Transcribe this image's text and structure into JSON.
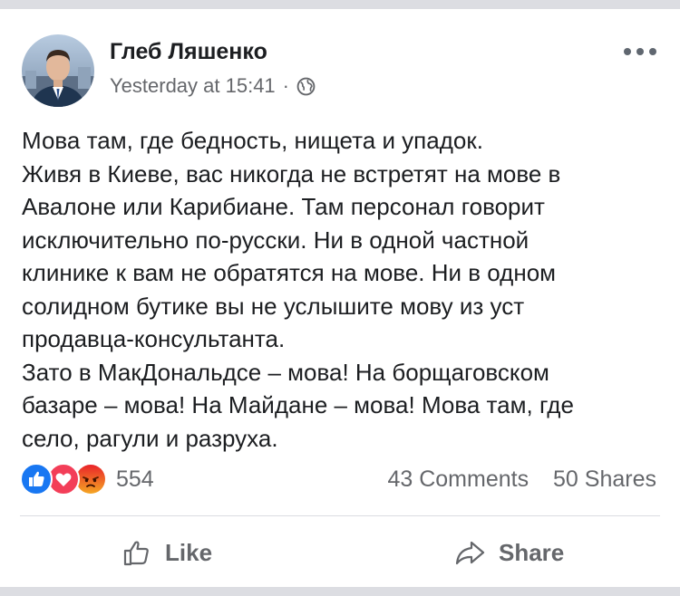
{
  "post": {
    "author": "Глеб Ляшенко",
    "timestamp": "Yesterday at 15:41",
    "separator": "·",
    "privacy_icon": "globe-icon",
    "more_icon": "more-options-icon",
    "text_lines": [
      "Мова там, где бедность, нищета и упадок.",
      "Живя в Киеве, вас никогда не встретят на мове в",
      "Авалоне или Карибиане. Там персонал говорит",
      "исключительно по-русски. Ни в одной частной",
      "клинике к вам не обратятся на мове. Ни в одном",
      "солидном бутике вы не услышите мову из уст",
      "продавца-консультанта.",
      "Зато в МакДональдсе – мова! На борщаговском",
      "базаре – мова! На Майдане – мова! Мова там, где",
      "село, рагули и разруха."
    ]
  },
  "reactions": {
    "icons": [
      "like-reaction-icon",
      "love-reaction-icon",
      "angry-reaction-icon"
    ],
    "count": "554"
  },
  "stats": {
    "comments": "43 Comments",
    "shares": "50 Shares"
  },
  "actions": {
    "like_label": "Like",
    "share_label": "Share"
  },
  "colors": {
    "text": "#1c1e21",
    "secondary": "#65676b",
    "like_blue": "#1877f2",
    "love_red": "#f33e58",
    "angry_orange": "#e9710f",
    "background": "#dcdde2"
  }
}
